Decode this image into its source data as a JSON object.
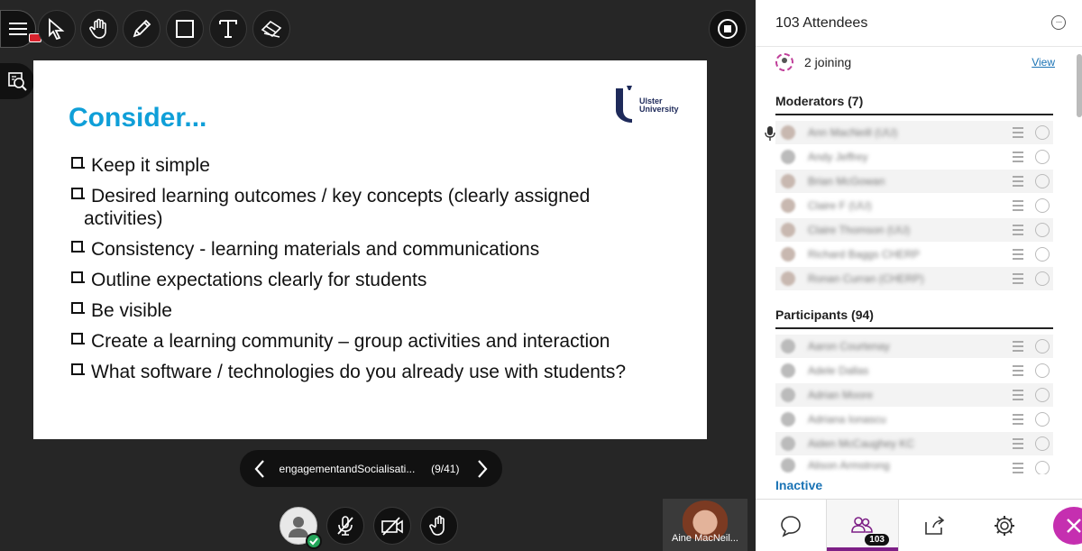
{
  "toolbar": {
    "tools": [
      "menu",
      "select",
      "pan",
      "pen",
      "shape",
      "text",
      "eraser"
    ],
    "icon_names": [
      "menu-icon",
      "pointer-icon",
      "hand-icon",
      "pencil-icon",
      "rectangle-icon",
      "text-icon",
      "eraser-icon"
    ]
  },
  "slide": {
    "title": "Consider...",
    "logo_text_1": "Ulster",
    "logo_text_2": "University",
    "bullets": [
      "Keep it simple",
      "Desired learning outcomes / key concepts (clearly assigned",
      "Consistency - learning materials and communications",
      "Outline expectations clearly for students",
      "Be visible",
      "Create a learning community – group activities and interaction",
      "What software / technologies do you already use with students?"
    ],
    "bullet_continuation": "activities)"
  },
  "slide_nav": {
    "file_name": "engagementandSocialisati...",
    "position": "(9/41)"
  },
  "video": {
    "name": "Aine MacNeil..."
  },
  "panel": {
    "title": "103 Attendees",
    "joining_text": "2 joining",
    "view_link": "View",
    "moderators_title": "Moderators (7)",
    "moderators": [
      "Ann MacNeill (UU)",
      "Andy Jeffrey",
      "Brian McGowan",
      "Claire F (UU)",
      "Claire Thomson (UU)",
      "Richard Baggs CHERP",
      "Ronan Curran (CHERP)"
    ],
    "participants_title": "Participants (94)",
    "participants": [
      "Aaron Courtenay",
      "Adele Dallas",
      "Adrian Moore",
      "Adriana Ionascu",
      "Aiden McCaughey KC",
      "Alison Armstrong"
    ],
    "inactive_label": "Inactive",
    "attendee_badge": "103"
  },
  "colors": {
    "accent": "#7d1f86",
    "close_button": "#c52fb0",
    "slide_title": "#0f9fd8",
    "link": "#1a73b5",
    "status_ok": "#23a55a",
    "record": "#d9232e"
  }
}
